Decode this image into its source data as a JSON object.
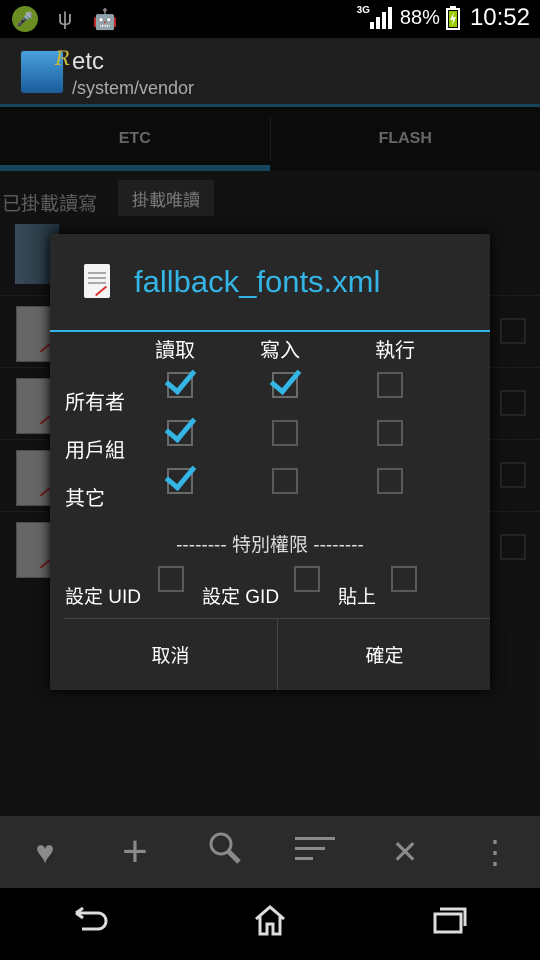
{
  "status_bar": {
    "network": "3G",
    "battery": "88%",
    "time": "10:52"
  },
  "action_bar": {
    "title": "etc",
    "subtitle": "/system/vendor"
  },
  "tabs": [
    "ETC",
    "FLASH"
  ],
  "mount": {
    "label": "已掛載讀寫",
    "button": "掛載唯讀"
  },
  "dialog": {
    "title": "fallback_fonts.xml",
    "columns": [
      "讀取",
      "寫入",
      "執行"
    ],
    "rows": [
      {
        "label": "所有者",
        "read": true,
        "write": true,
        "exec": false
      },
      {
        "label": "用戶組",
        "read": true,
        "write": false,
        "exec": false
      },
      {
        "label": "其它",
        "read": true,
        "write": false,
        "exec": false
      }
    ],
    "special_header": "-------- 特別權限 --------",
    "special_options": [
      "設定 UID",
      "設定 GID",
      "貼上"
    ],
    "cancel": "取消",
    "ok": "確定"
  },
  "bottom_toolbar": [
    "heart-icon",
    "plus-icon",
    "search-icon",
    "sort-icon",
    "close-icon",
    "overflow-icon"
  ],
  "nav_bar": [
    "back-icon",
    "home-icon",
    "recents-icon"
  ]
}
